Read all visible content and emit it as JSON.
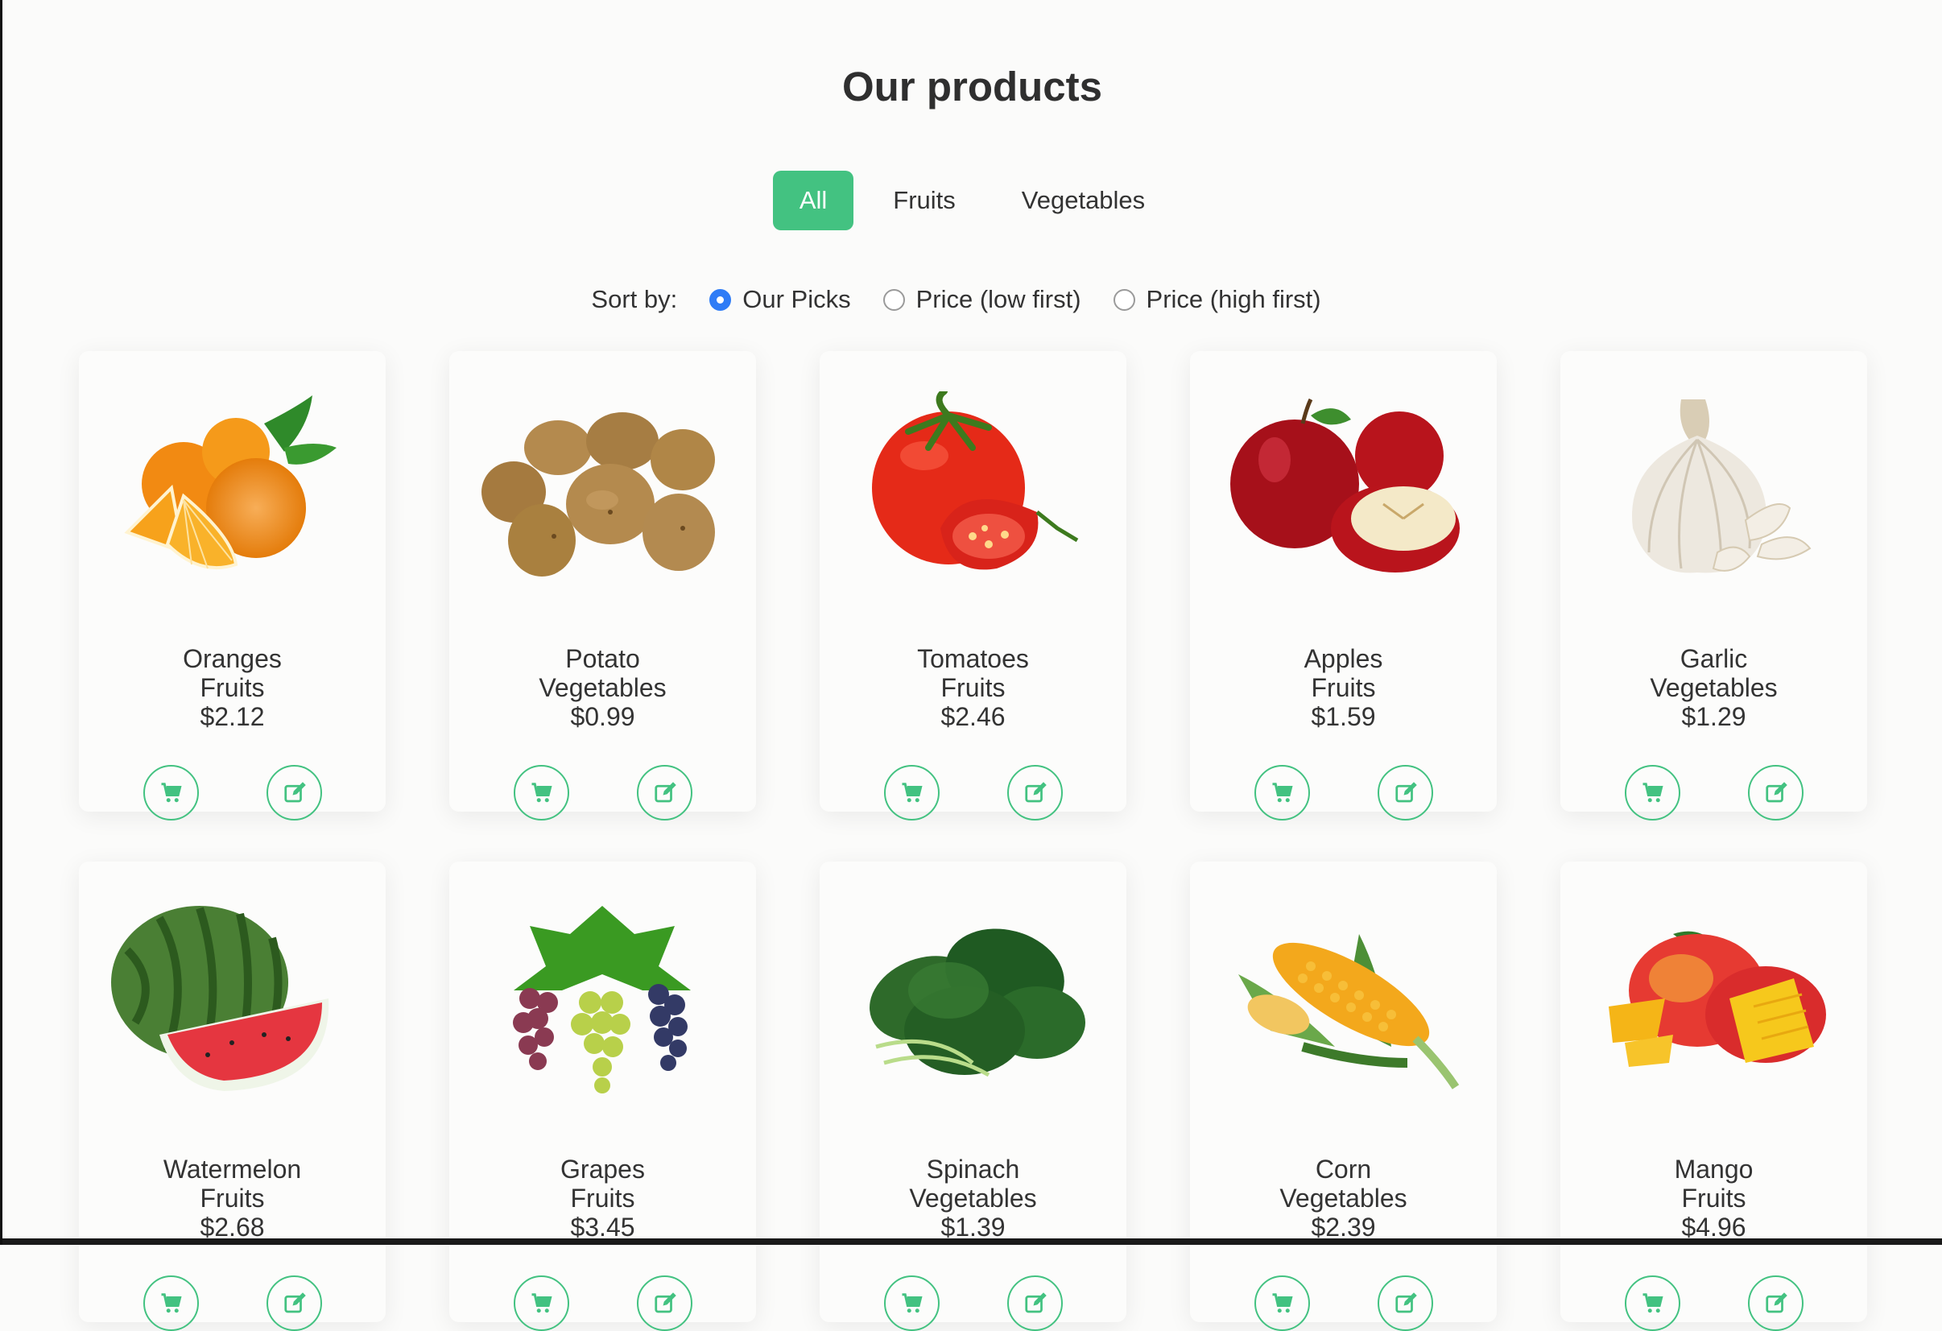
{
  "page_title": "Our products",
  "filters": [
    {
      "label": "All",
      "active": true
    },
    {
      "label": "Fruits",
      "active": false
    },
    {
      "label": "Vegetables",
      "active": false
    }
  ],
  "sort": {
    "label": "Sort by:",
    "options": [
      {
        "label": "Our Picks",
        "checked": true
      },
      {
        "label": "Price (low first)",
        "checked": false
      },
      {
        "label": "Price (high first)",
        "checked": false
      }
    ]
  },
  "products": [
    {
      "name": "Oranges",
      "category": "Fruits",
      "price": "$2.12",
      "icon": "orange-icon"
    },
    {
      "name": "Potato",
      "category": "Vegetables",
      "price": "$0.99",
      "icon": "potato-icon"
    },
    {
      "name": "Tomatoes",
      "category": "Fruits",
      "price": "$2.46",
      "icon": "tomato-icon"
    },
    {
      "name": "Apples",
      "category": "Fruits",
      "price": "$1.59",
      "icon": "apple-icon"
    },
    {
      "name": "Garlic",
      "category": "Vegetables",
      "price": "$1.29",
      "icon": "garlic-icon"
    },
    {
      "name": "Watermelon",
      "category": "Fruits",
      "price": "$2.68",
      "icon": "watermelon-icon"
    },
    {
      "name": "Grapes",
      "category": "Fruits",
      "price": "$3.45",
      "icon": "grapes-icon"
    },
    {
      "name": "Spinach",
      "category": "Vegetables",
      "price": "$1.39",
      "icon": "spinach-icon"
    },
    {
      "name": "Corn",
      "category": "Vegetables",
      "price": "$2.39",
      "icon": "corn-icon"
    },
    {
      "name": "Mango",
      "category": "Fruits",
      "price": "$4.96",
      "icon": "mango-icon"
    }
  ],
  "colors": {
    "accent": "#43c281",
    "radio_checked": "#2f7cf6"
  }
}
